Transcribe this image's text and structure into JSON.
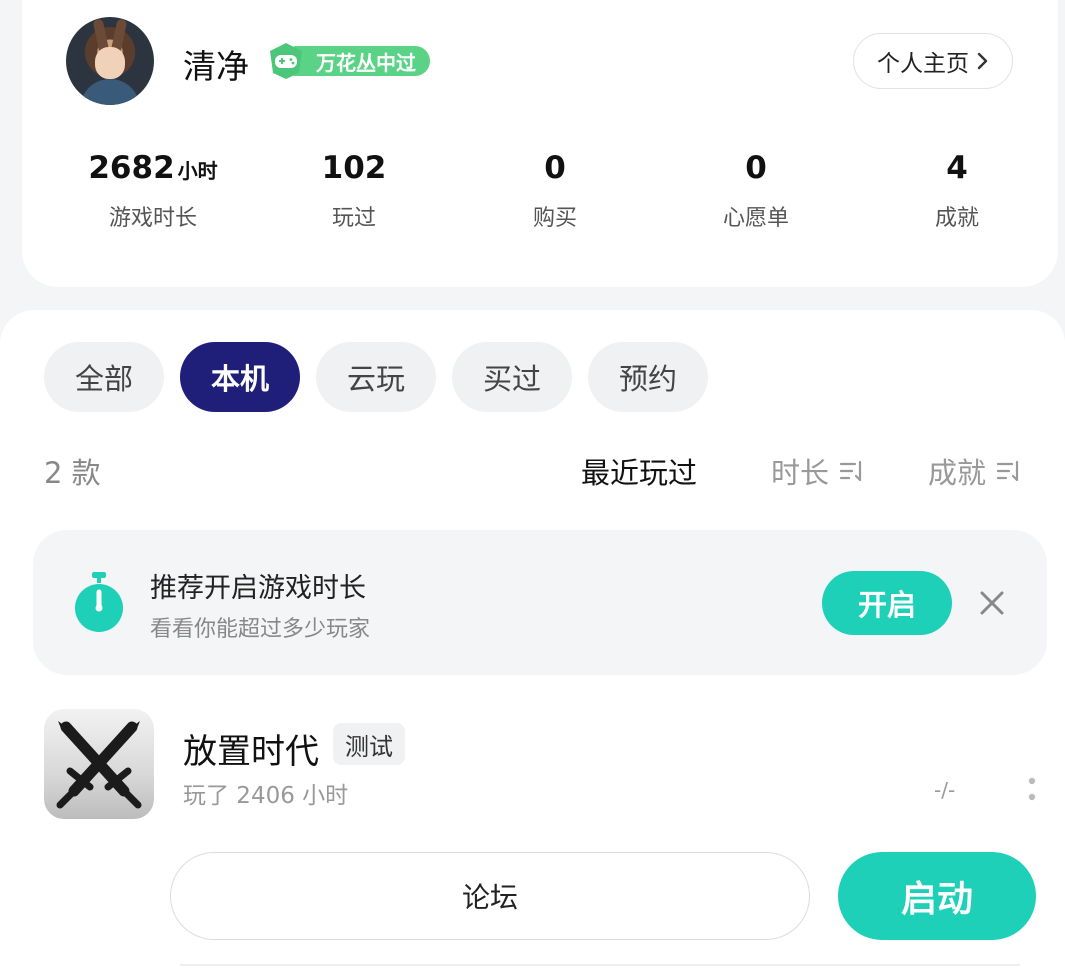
{
  "profile": {
    "username": "清净",
    "badge_label": "万花丛中过",
    "homepage_label": "个人主页",
    "stats": [
      {
        "value": "2682",
        "unit": "小时",
        "label": "游戏时长"
      },
      {
        "value": "102",
        "unit": "",
        "label": "玩过"
      },
      {
        "value": "0",
        "unit": "",
        "label": "购买"
      },
      {
        "value": "0",
        "unit": "",
        "label": "心愿单"
      },
      {
        "value": "4",
        "unit": "",
        "label": "成就"
      }
    ]
  },
  "tabs": [
    "全部",
    "本机",
    "云玩",
    "买过",
    "预约"
  ],
  "active_tab": "本机",
  "list": {
    "count": "2 款",
    "sort_options": [
      "最近玩过",
      "时长",
      "成就"
    ],
    "active_sort": "最近玩过"
  },
  "recommend": {
    "title": "推荐开启游戏时长",
    "subtitle": "看看你能超过多少玩家",
    "button": "开启"
  },
  "game": {
    "name": "放置时代",
    "tag": "测试",
    "played": "玩了 2406 小时",
    "rating": "-/-",
    "forum_button": "论坛",
    "start_button": "启动"
  },
  "colors": {
    "accent": "#1ed0b8",
    "tab_active": "#1f1f7a",
    "badge": "#5bd387"
  }
}
